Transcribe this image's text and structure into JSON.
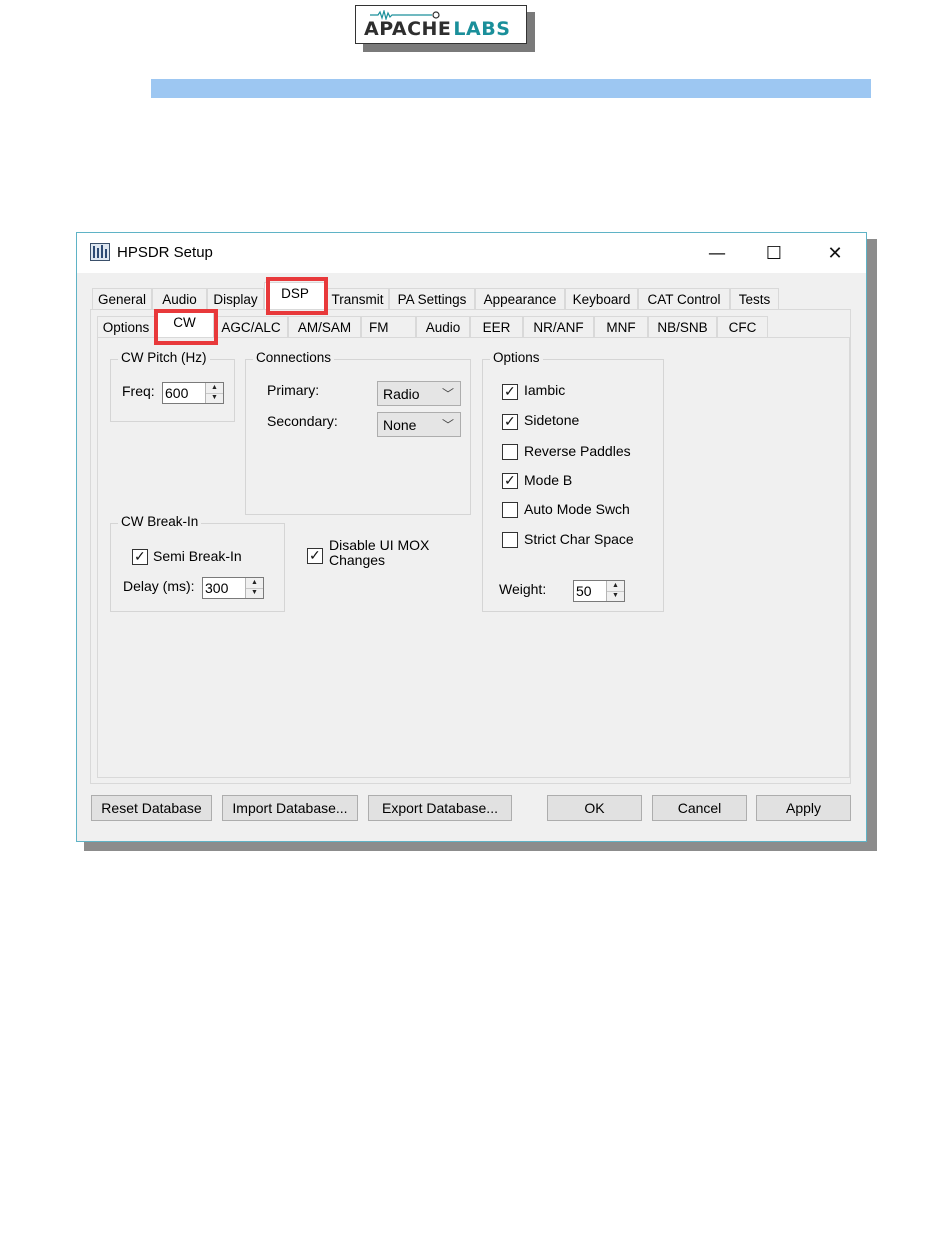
{
  "logo": {
    "word1": "APACHE",
    "word2": "LABS"
  },
  "window": {
    "title": "HPSDR Setup",
    "controls": {
      "minimize": "—",
      "maximize": "☐",
      "close": "✕"
    }
  },
  "main_tabs": [
    "General",
    "Audio",
    "Display",
    "DSP",
    "Transmit",
    "PA Settings",
    "Appearance",
    "Keyboard",
    "CAT Control",
    "Tests"
  ],
  "main_tab_selected": "DSP",
  "sub_tabs": [
    "Options",
    "CW",
    "AGC/ALC",
    "AM/SAM",
    "FM",
    "Audio",
    "EER",
    "NR/ANF",
    "MNF",
    "NB/SNB",
    "CFC"
  ],
  "sub_tab_selected": "CW",
  "cw_pitch": {
    "title": "CW Pitch (Hz)",
    "freq_label": "Freq:",
    "freq_value": "600"
  },
  "connections": {
    "title": "Connections",
    "primary_label": "Primary:",
    "primary_value": "Radio",
    "secondary_label": "Secondary:",
    "secondary_value": "None"
  },
  "options": {
    "title": "Options",
    "checkboxes": [
      {
        "label": "Iambic",
        "checked": true
      },
      {
        "label": "Sidetone",
        "checked": true
      },
      {
        "label": "Reverse Paddles",
        "checked": false
      },
      {
        "label": "Mode B",
        "checked": true
      },
      {
        "label": "Auto Mode Swch",
        "checked": false
      },
      {
        "label": "Strict Char Space",
        "checked": false
      }
    ],
    "weight_label": "Weight:",
    "weight_value": "50"
  },
  "break_in": {
    "title": "CW Break-In",
    "semi_label": "Semi Break-In",
    "semi_checked": true,
    "delay_label": "Delay (ms):",
    "delay_value": "300"
  },
  "disable_mox": {
    "line1": "Disable UI MOX",
    "line2": "Changes",
    "checked": true
  },
  "buttons": {
    "reset": "Reset Database",
    "import": "Import Database...",
    "export": "Export Database...",
    "ok": "OK",
    "cancel": "Cancel",
    "apply": "Apply"
  },
  "colors": {
    "highlight": "#e8393b",
    "header_bar": "#9dc7f2",
    "logo_accent": "#1a8f9a"
  }
}
